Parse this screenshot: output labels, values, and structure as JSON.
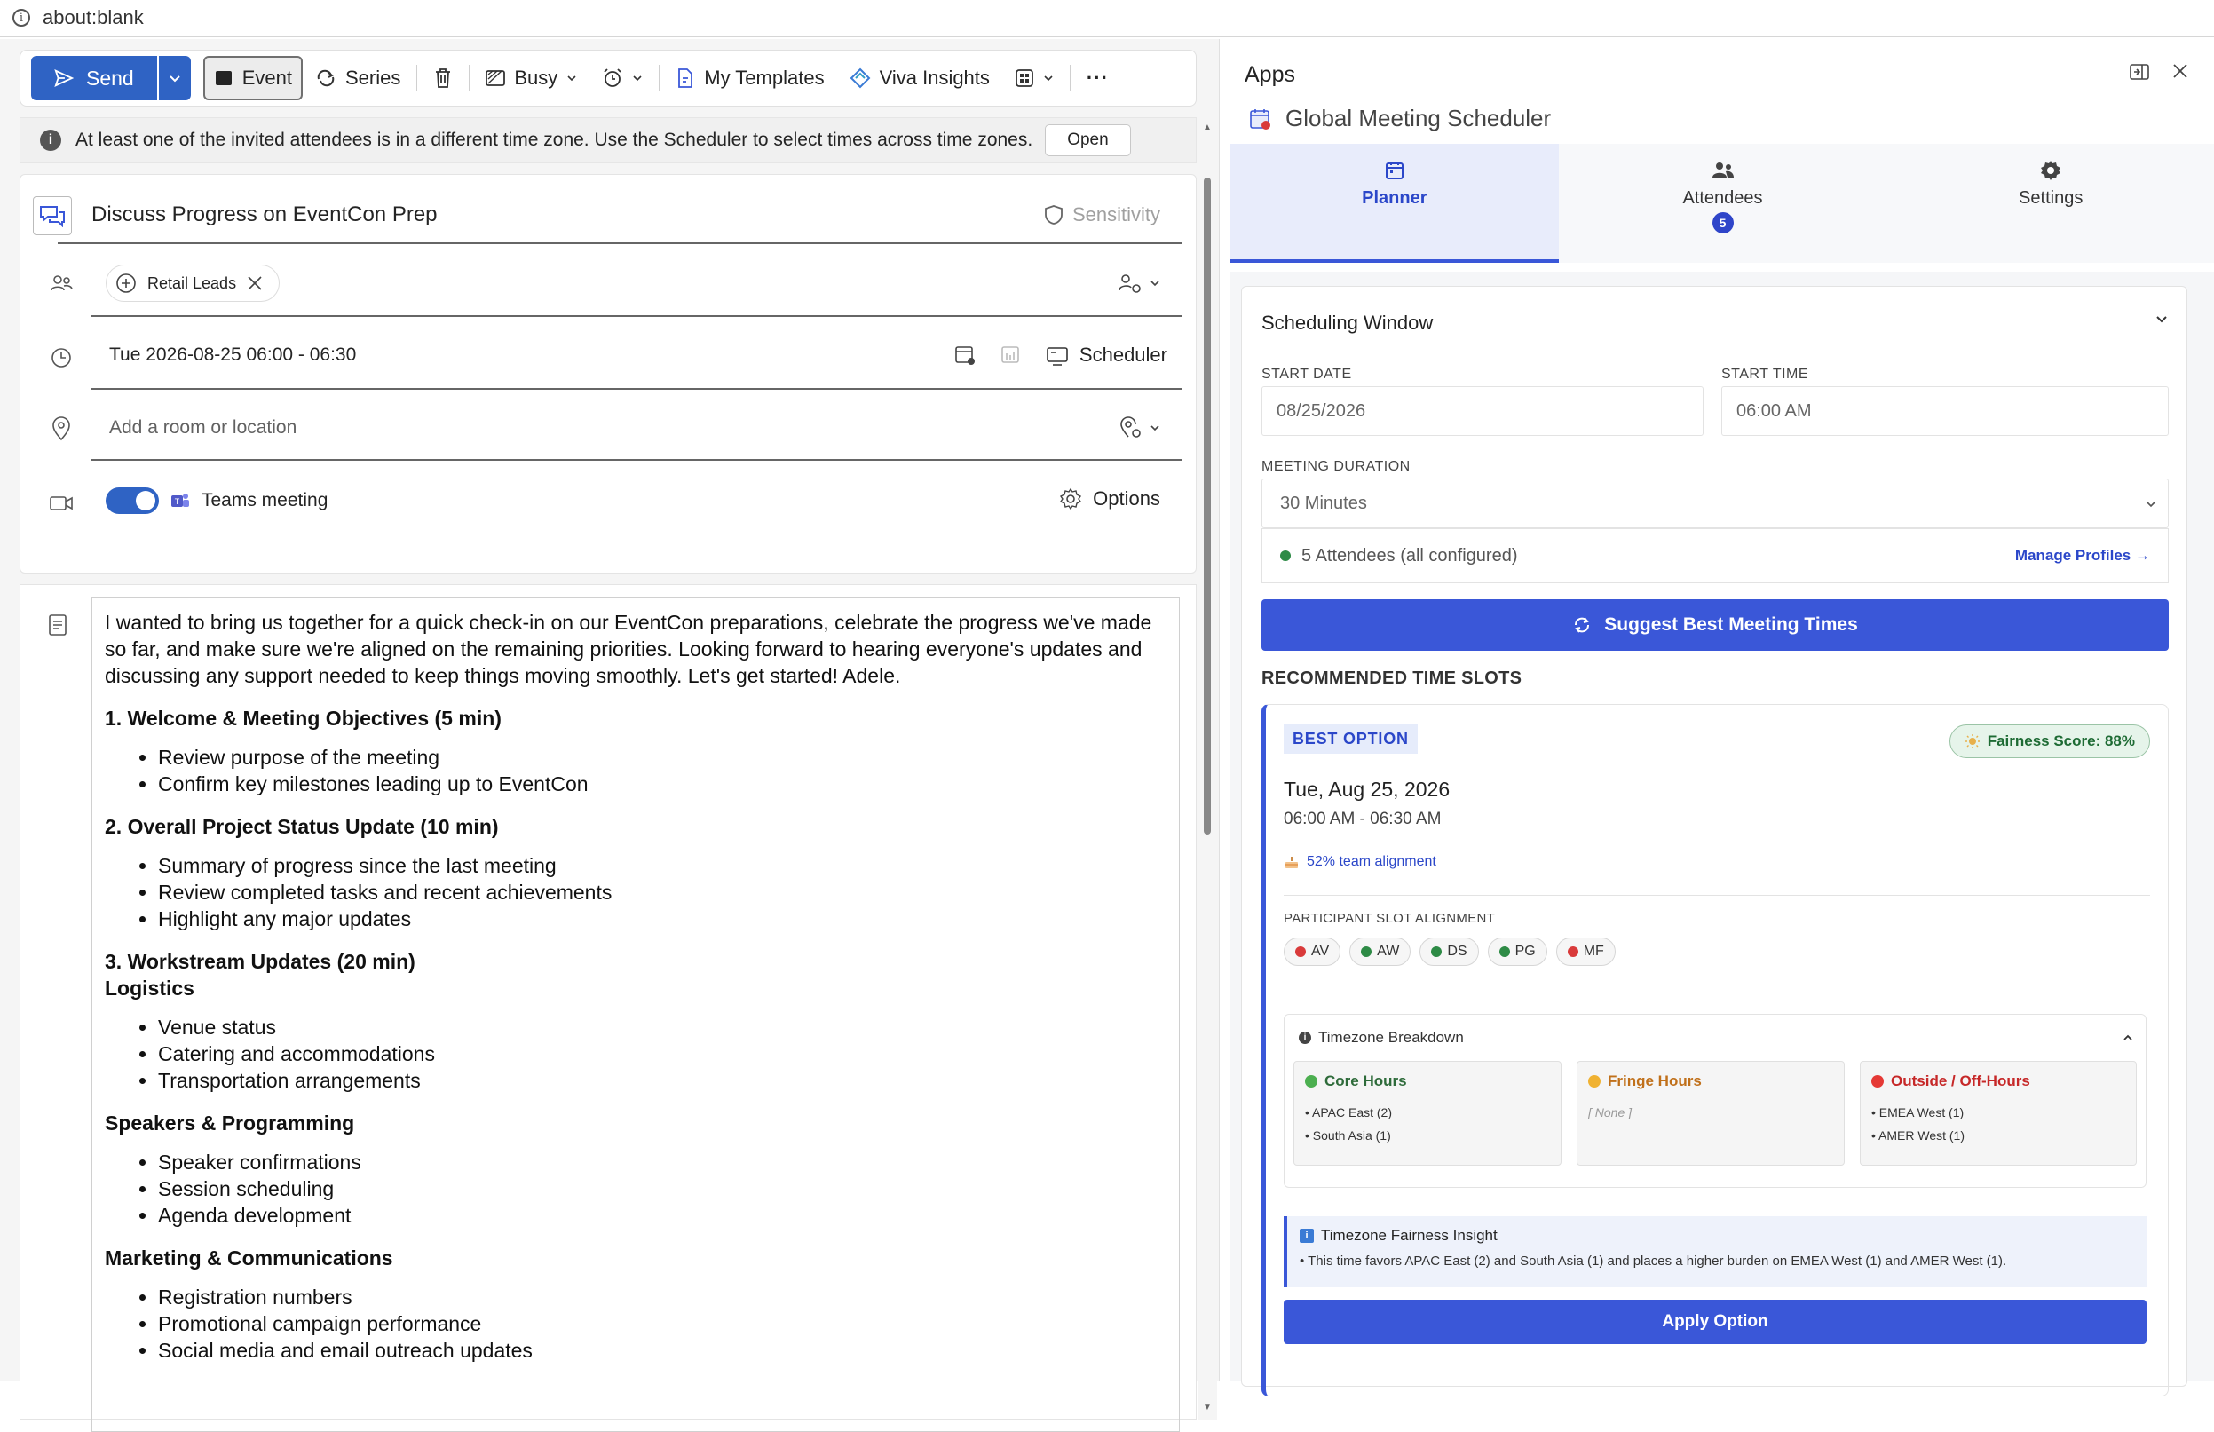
{
  "browser": {
    "url": "about:blank"
  },
  "toolbar": {
    "send_label": "Send",
    "event_label": "Event",
    "series_label": "Series",
    "busy_label": "Busy",
    "templates_label": "My Templates",
    "viva_label": "Viva Insights",
    "more_label": "···"
  },
  "notice": {
    "text": "At least one of the invited attendees is in a different time zone. Use the Scheduler to select times across time zones.",
    "button_label": "Open"
  },
  "form": {
    "subject": "Discuss Progress on EventCon Prep",
    "sensitivity_label": "Sensitivity",
    "attendee_chip": "Retail Leads",
    "datetime": "Tue 2026-08-25 06:00 - 06:30",
    "scheduler_label": "Scheduler",
    "location_placeholder": "Add a room or location",
    "teams_label": "Teams meeting",
    "options_label": "Options"
  },
  "body": {
    "intro": "I wanted to bring us together for a quick check-in on our EventCon preparations, celebrate the progress we've made so far, and make sure we're aligned on the remaining priorities. Looking forward to hearing everyone's updates and discussing any support needed to keep things moving smoothly. Let's get started! Adele.",
    "s1_title": "1. Welcome & Meeting Objectives (5 min)",
    "s1_items": [
      "Review purpose of the meeting",
      "Confirm key milestones leading up to EventCon"
    ],
    "s2_title": "2. Overall Project Status Update (10 min)",
    "s2_items": [
      "Summary of progress since the last meeting",
      "Review completed tasks and recent achievements",
      "Highlight any major updates"
    ],
    "s3_title": "3. Workstream Updates (20 min)",
    "s3_sub": "Logistics",
    "s3_items": [
      "Venue status",
      "Catering and accommodations",
      "Transportation arrangements"
    ],
    "s4_title": "Speakers & Programming",
    "s4_items": [
      "Speaker confirmations",
      "Session scheduling",
      "Agenda development"
    ],
    "s5_title": "Marketing & Communications",
    "s5_items": [
      "Registration numbers",
      "Promotional campaign performance",
      "Social media and email outreach updates"
    ]
  },
  "panel": {
    "title": "Apps",
    "addin_title": "Global Meeting Scheduler",
    "tabs": [
      {
        "label": "Planner"
      },
      {
        "label": "Attendees",
        "badge": "5"
      },
      {
        "label": "Settings"
      }
    ],
    "scheduling_window": "Scheduling Window",
    "start_date_label": "START DATE",
    "start_date_value": "08/25/2026",
    "start_time_label": "START TIME",
    "start_time_value": "06:00  AM",
    "duration_label": "MEETING DURATION",
    "duration_value": "30 Minutes",
    "attendees_status": "5 Attendees (all configured)",
    "manage_profiles": "Manage Profiles →",
    "suggest_label": "Suggest Best Meeting Times",
    "recommended_title": "RECOMMENDED TIME SLOTS",
    "slot": {
      "best_label": "BEST OPTION",
      "fairness": "Fairness Score: 88%",
      "date": "Tue, Aug 25, 2026",
      "time": "06:00 AM - 06:30 AM",
      "alignment": "52% team alignment",
      "participant_label": "PARTICIPANT SLOT ALIGNMENT",
      "participants": [
        {
          "initials": "AV",
          "color": "#d93a3a"
        },
        {
          "initials": "AW",
          "color": "#2e8b46"
        },
        {
          "initials": "DS",
          "color": "#2e8b46"
        },
        {
          "initials": "PG",
          "color": "#2e8b46"
        },
        {
          "initials": "MF",
          "color": "#d93a3a"
        }
      ],
      "tz_title": "Timezone Breakdown",
      "core_title": "Core Hours",
      "core_items": [
        "• APAC East (2)",
        "• South Asia (1)"
      ],
      "fringe_title": "Fringe Hours",
      "fringe_items": [
        "[ None ]"
      ],
      "outside_title": "Outside / Off-Hours",
      "outside_items": [
        "• EMEA West (1)",
        "• AMER West (1)"
      ],
      "insight_title": "Timezone Fairness Insight",
      "insight_text": "• This time favors APAC East (2) and South Asia (1) and places a higher burden on EMEA West (1) and AMER West (1).",
      "apply_label": "Apply Option"
    }
  },
  "colors": {
    "accent": "#3a57d8",
    "send": "#2f63c4",
    "core": "#2e8b46",
    "fringe": "#c0701a",
    "outside": "#c62828"
  }
}
